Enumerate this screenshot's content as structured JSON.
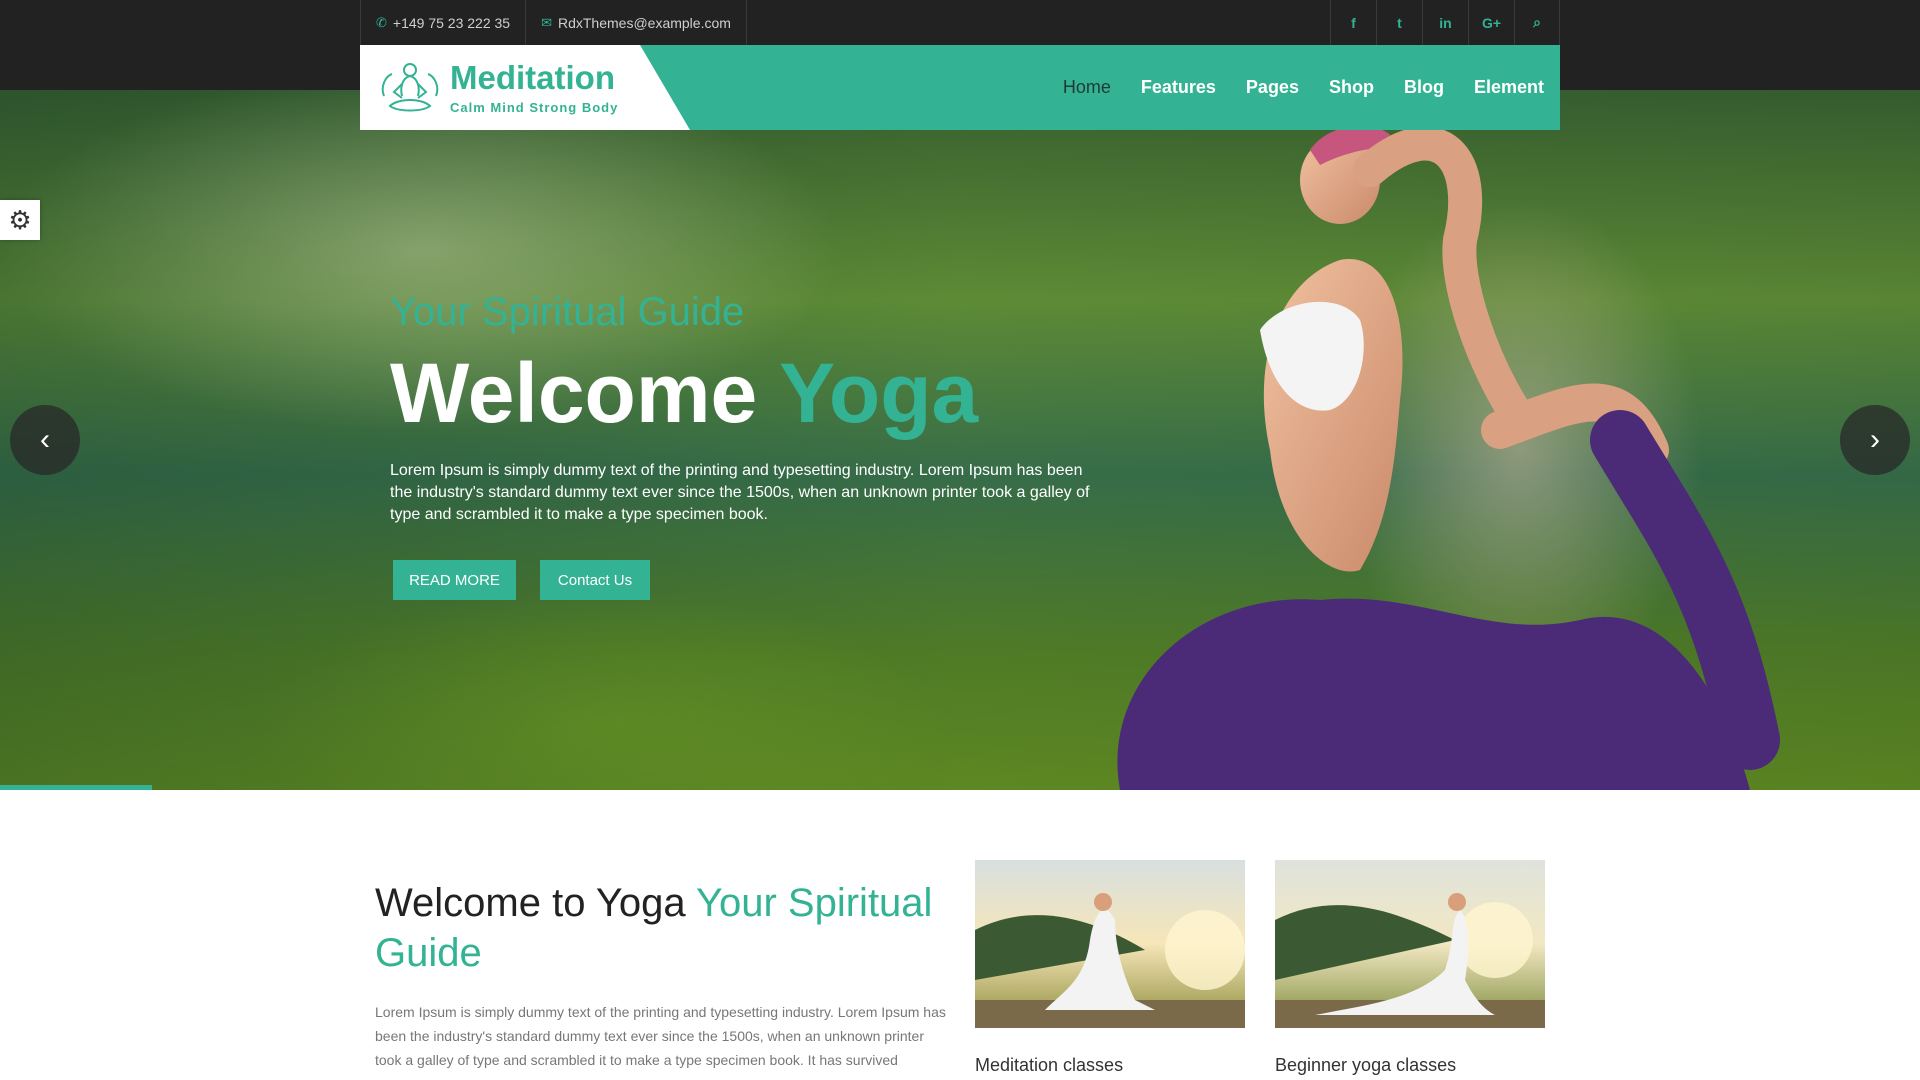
{
  "topbar": {
    "phone": "+149 75 23 222 35",
    "email": "RdxThemes@example.com",
    "social": [
      {
        "icon": "facebook-icon",
        "glyph": "f"
      },
      {
        "icon": "twitter-icon",
        "glyph": "t"
      },
      {
        "icon": "linkedin-icon",
        "glyph": "in"
      },
      {
        "icon": "google-plus-icon",
        "glyph": "G+"
      },
      {
        "icon": "search-icon",
        "glyph": "⌕"
      }
    ]
  },
  "header": {
    "logo_title": "Meditation",
    "logo_tagline": "Calm Mind Strong Body",
    "nav": [
      "Home",
      "Features",
      "Pages",
      "Shop",
      "Blog",
      "Element"
    ]
  },
  "hero": {
    "subtitle": "Your Spiritual Guide",
    "title_main": "Welcome",
    "title_accent": "Yoga",
    "text": "Lorem Ipsum is simply dummy text of the printing and typesetting industry. Lorem Ipsum has been the industry's standard dummy text ever since the 1500s, when an unknown printer took a galley of type and scrambled it to make a type specimen book.",
    "read_more": "READ MORE",
    "contact": "Contact Us",
    "prev_arrow": "‹",
    "next_arrow": "›",
    "settings_glyph": "⚙"
  },
  "about": {
    "title_main": "Welcome to Yoga",
    "title_accent": "Your Spiritual Guide",
    "text": "Lorem Ipsum is simply dummy text of the printing and typesetting industry. Lorem Ipsum has been the industry's standard dummy text ever since the 1500s, when an unknown printer took a galley of type and scrambled it to make a type specimen book. It has survived",
    "cards": [
      "Meditation classes",
      "Beginner yoga classes"
    ]
  },
  "colors": {
    "accent": "#33b393",
    "topbar": "#222222"
  }
}
